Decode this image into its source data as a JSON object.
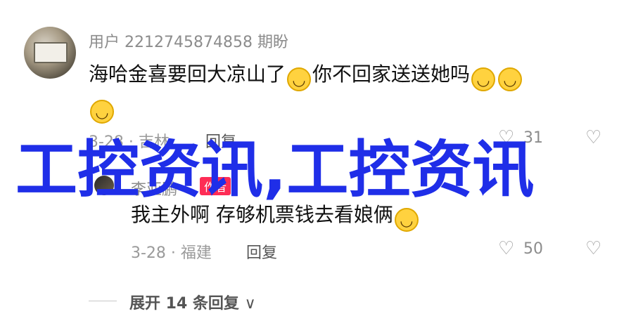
{
  "comment": {
    "username": "用户 2212745874858 期盼",
    "text_part1": "海哈金喜要回大凉山了",
    "emoji1": "😁",
    "text_part2": "你不回家送送她吗",
    "emoji2": "🤣",
    "emoji3": "🤣",
    "emoji4": "🤣",
    "date_location": "3-28 · 吉林",
    "reply_label": "回复",
    "like_count": "31"
  },
  "reply": {
    "username": "李亚鹏",
    "author_badge": "作者",
    "text": "我主外啊 存够机票钱去看娘俩",
    "emoji": "🤣",
    "date_location": "3-28 · 福建",
    "reply_label": "回复",
    "like_count": "50"
  },
  "expand": {
    "label": "展开 14 条回复",
    "chevron": "∨"
  },
  "watermark": {
    "text": "工控资讯,工控资讯",
    "color": "#1f2ee8"
  },
  "icons": {
    "like": "heart-outline-icon",
    "dislike": "broken-heart-icon"
  },
  "colors": {
    "author_badge": "#fe2c55"
  }
}
